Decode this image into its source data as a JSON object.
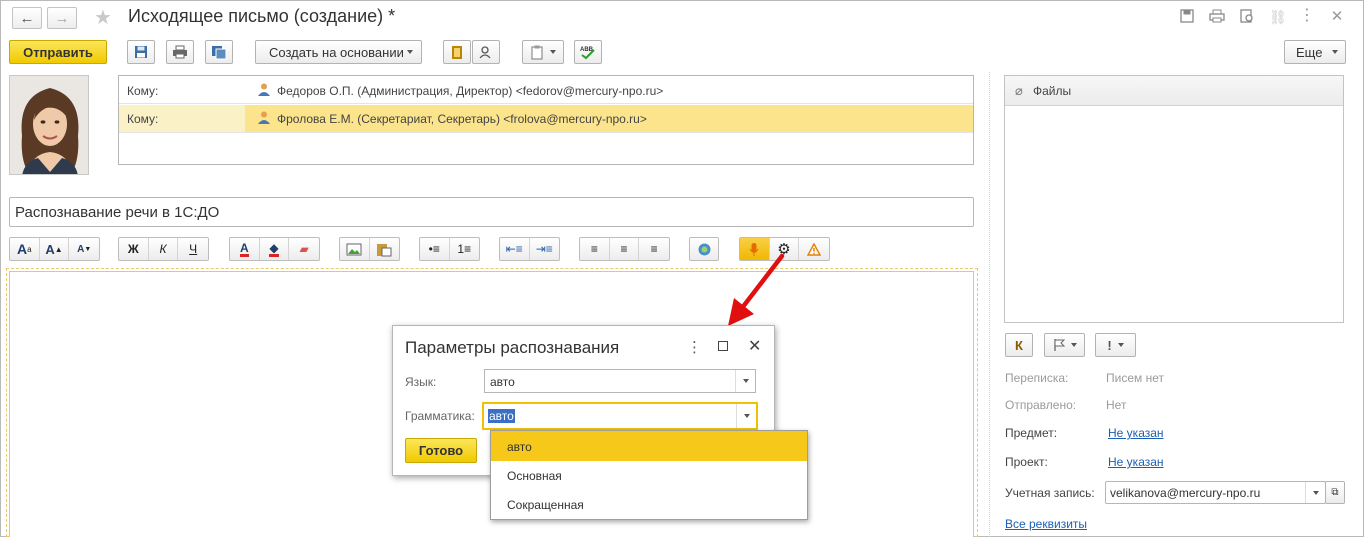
{
  "window": {
    "title": "Исходящее письмо (создание) *"
  },
  "toolbar": {
    "send_label": "Отправить",
    "create_basis_label": "Создать на основании",
    "more_label": "Еще"
  },
  "recipients": [
    {
      "label": "Кому:",
      "value": "Федоров О.П. (Администрация, Директор) <fedorov@mercury-npo.ru>"
    },
    {
      "label": "Кому:",
      "value": "Фролова Е.М. (Секретариат, Секретарь) <frolova@mercury-npo.ru>"
    }
  ],
  "subject": {
    "value": "Распознавание речи в 1С:ДО"
  },
  "format_bar": {
    "bold": "Ж",
    "italic": "К",
    "underline": "Ч"
  },
  "dialog": {
    "title": "Параметры распознавания",
    "language_label": "Язык:",
    "language_value": "авто",
    "grammar_label": "Грамматика:",
    "grammar_value": "авто",
    "ok_label": "Готово",
    "options": [
      "авто",
      "Основная",
      "Сокращенная"
    ],
    "selected_index": 0
  },
  "files_panel": {
    "title": "Файлы"
  },
  "side_buttons": {
    "k_label": "К",
    "excl_label": "!"
  },
  "meta": {
    "correspondence_label": "Переписка:",
    "correspondence_value": "Писем нет",
    "sent_label": "Отправлено:",
    "sent_value": "Нет",
    "subject_label": "Предмет:",
    "subject_value": "Не указан",
    "project_label": "Проект:",
    "project_value": "Не указан",
    "account_label": "Учетная запись:",
    "account_value": "velikanova@mercury-npo.ru",
    "all_details_link": "Все реквизиты"
  },
  "colors": {
    "accent_yellow": "#f4d000",
    "selection_yellow": "#fbe48c",
    "arrow_red": "#e11010",
    "link_blue": "#1a5fb4"
  },
  "icons": [
    "back-icon",
    "forward-icon",
    "star-icon",
    "save-icon",
    "print-icon",
    "preview-icon",
    "link-icon",
    "more-icon",
    "close-icon",
    "paperclip-icon",
    "microphone-icon",
    "settings-icon",
    "warning-icon",
    "person-icon",
    "flag-icon"
  ]
}
